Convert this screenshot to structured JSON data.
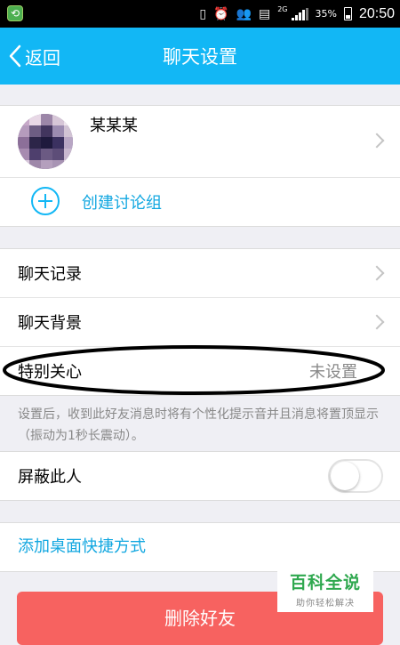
{
  "status_bar": {
    "network_label": "2G",
    "battery": "35%",
    "time": "20:50"
  },
  "nav": {
    "back_label": "返回",
    "title": "聊天设置"
  },
  "profile": {
    "name": "某某某"
  },
  "create_group": {
    "label": "创建讨论组"
  },
  "menu": {
    "chat_history": "聊天记录",
    "chat_background": "聊天背景",
    "special_care": "特别关心",
    "special_care_value": "未设置"
  },
  "hint": "设置后，收到此好友消息时将有个性化提示音并且消息将置顶显示（振动为1秒长震动）。",
  "block": {
    "label": "屏蔽此人",
    "enabled": false
  },
  "shortcut_label": "添加桌面快捷方式",
  "delete_label": "删除好友",
  "watermark": {
    "title": "百科全说",
    "subtitle": "助你轻松解决"
  },
  "colors": {
    "accent": "#12b7f5",
    "danger": "#f76260",
    "background": "#efeff4"
  }
}
